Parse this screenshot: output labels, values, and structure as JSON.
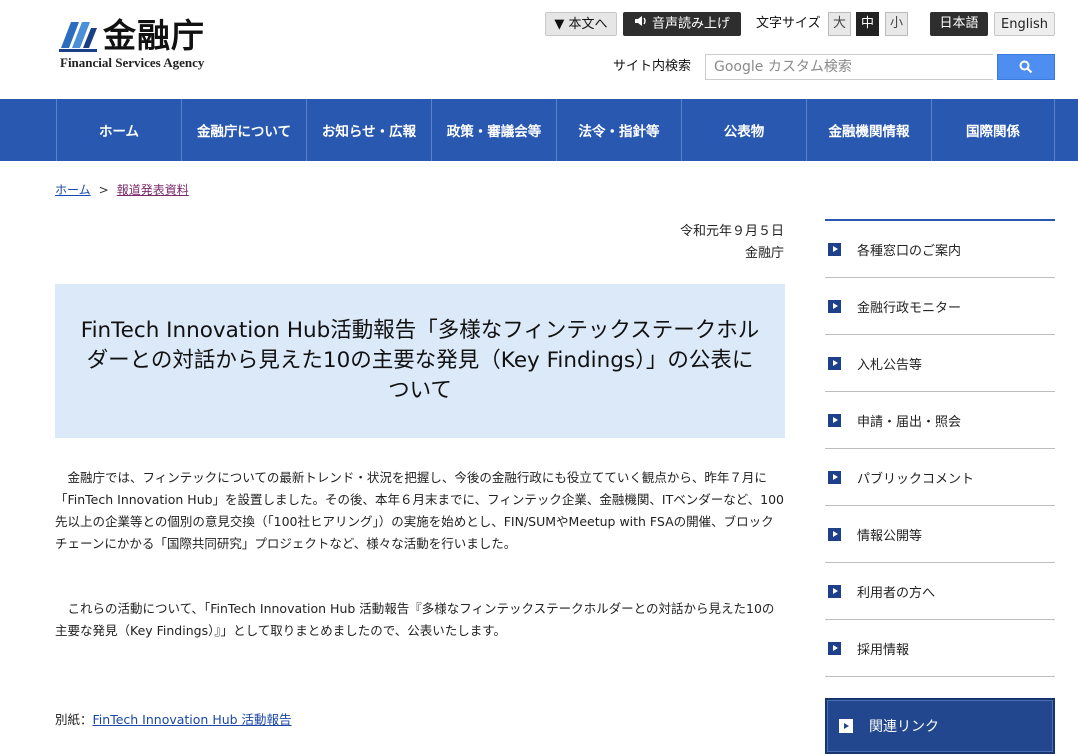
{
  "header": {
    "logo_jp": "金融庁",
    "logo_en": "Financial Services Agency",
    "skip_label": "▼ 本文へ",
    "audio_label": "音声読み上げ",
    "text_size_label": "文字サイズ",
    "text_size_large": "大",
    "text_size_medium": "中",
    "text_size_small": "小",
    "lang_ja": "日本語",
    "lang_en": "English",
    "search_label": "サイト内検索",
    "search_placeholder": "Google カスタム検索"
  },
  "nav": {
    "items": [
      {
        "label": "ホーム"
      },
      {
        "label": "金融庁について"
      },
      {
        "label": "お知らせ・広報"
      },
      {
        "label": "政策・審議会等"
      },
      {
        "label": "法令・指針等"
      },
      {
        "label": "公表物"
      },
      {
        "label": "金融機関情報"
      },
      {
        "label": "国際関係"
      }
    ]
  },
  "breadcrumb": {
    "home": "ホーム",
    "separator": ">",
    "current": "報道発表資料"
  },
  "article": {
    "date": "令和元年９月５日",
    "issuer": "金融庁",
    "title": "FinTech Innovation Hub活動報告「多様なフィンテックステークホルダーとの対話から見えた10の主要な発見（Key Findings）」の公表について",
    "paragraph1": "　金融庁では、フィンテックについての最新トレンド・状況を把握し、今後の金融行政にも役立てていく観点から、昨年７月に「FinTech Innovation Hub」を設置しました。その後、本年６月末までに、フィンテック企業、金融機関、ITベンダーなど、100先以上の企業等との個別の意見交換（「100社ヒアリング」）の実施を始めとし、FIN/SUMやMeetup with FSAの開催、ブロックチェーンにかかる「国際共同研究」プロジェクトなど、様々な活動を行いました。",
    "paragraph2": "　これらの活動について、「FinTech Innovation Hub 活動報告『多様なフィンテックステークホルダーとの対話から見えた10の主要な発見（Key Findings）』」として取りまとめましたので、公表いたします。",
    "attachment_prefix": "別紙：",
    "attachment_link": "FinTech Innovation Hub 活動報告"
  },
  "sidebar": {
    "items": [
      {
        "label": "各種窓口のご案内"
      },
      {
        "label": "金融行政モニター"
      },
      {
        "label": "入札公告等"
      },
      {
        "label": "申請・届出・照会"
      },
      {
        "label": "パブリックコメント"
      },
      {
        "label": "情報公開等"
      },
      {
        "label": "利用者の方へ"
      },
      {
        "label": "採用情報"
      }
    ],
    "related_label": "関連リンク"
  },
  "colors": {
    "nav_blue": "#2858b0",
    "title_bg": "#dce9f8",
    "search_blue": "#4d8ef0",
    "link_blue": "#1a47a8"
  }
}
